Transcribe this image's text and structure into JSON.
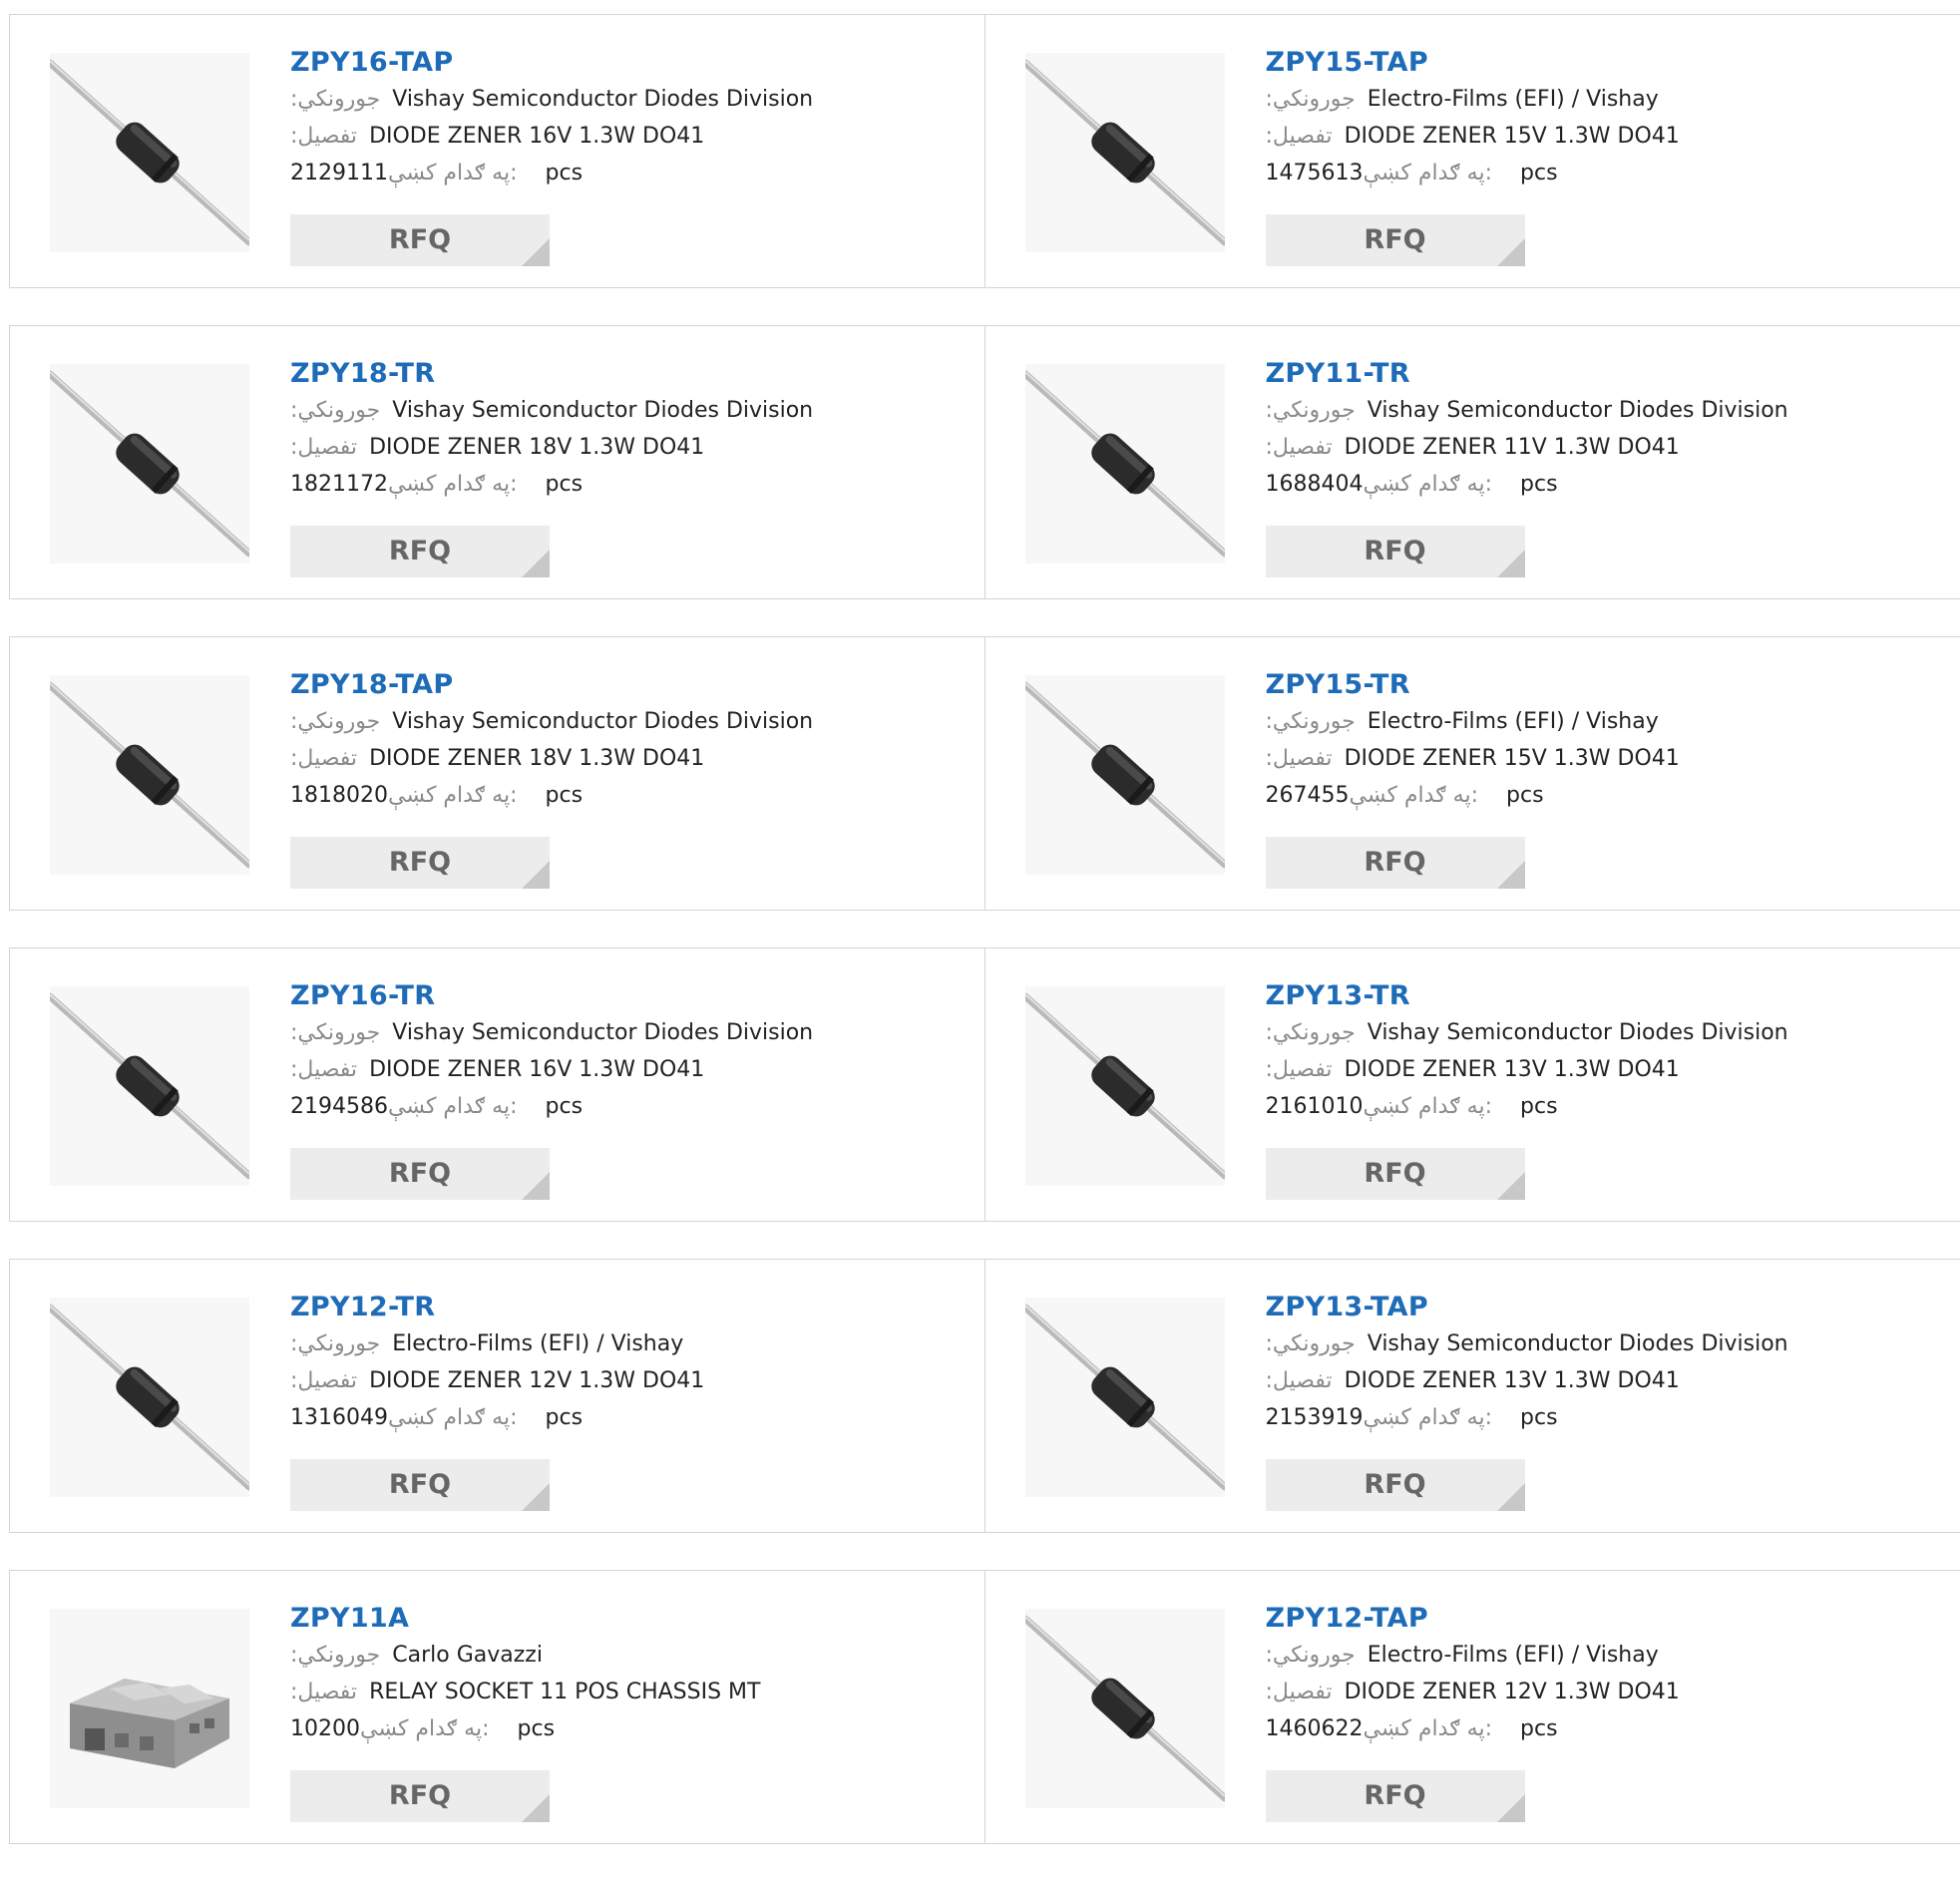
{
  "labels": {
    "manufacturer": ":جورونکي",
    "description": ":تفصيل",
    "stock": "په ګدام کښې:",
    "unit": "pcs",
    "rfq": "RFQ"
  },
  "products": [
    {
      "part": "ZPY16-TAP",
      "manufacturer": "Vishay Semiconductor Diodes Division",
      "description": "DIODE ZENER 16V 1.3W DO41",
      "stock": "2129111",
      "image": "diode-icon"
    },
    {
      "part": "ZPY15-TAP",
      "manufacturer": "Electro-Films (EFI) / Vishay",
      "description": "DIODE ZENER 15V 1.3W DO41",
      "stock": "1475613",
      "image": "diode-icon"
    },
    {
      "part": "ZPY18-TR",
      "manufacturer": "Vishay Semiconductor Diodes Division",
      "description": "DIODE ZENER 18V 1.3W DO41",
      "stock": "1821172",
      "image": "diode-icon"
    },
    {
      "part": "ZPY11-TR",
      "manufacturer": "Vishay Semiconductor Diodes Division",
      "description": "DIODE ZENER 11V 1.3W DO41",
      "stock": "1688404",
      "image": "diode-icon"
    },
    {
      "part": "ZPY18-TAP",
      "manufacturer": "Vishay Semiconductor Diodes Division",
      "description": "DIODE ZENER 18V 1.3W DO41",
      "stock": "1818020",
      "image": "diode-icon"
    },
    {
      "part": "ZPY15-TR",
      "manufacturer": "Electro-Films (EFI) / Vishay",
      "description": "DIODE ZENER 15V 1.3W DO41",
      "stock": "267455",
      "image": "diode-icon"
    },
    {
      "part": "ZPY16-TR",
      "manufacturer": "Vishay Semiconductor Diodes Division",
      "description": "DIODE ZENER 16V 1.3W DO41",
      "stock": "2194586",
      "image": "diode-icon"
    },
    {
      "part": "ZPY13-TR",
      "manufacturer": "Vishay Semiconductor Diodes Division",
      "description": "DIODE ZENER 13V 1.3W DO41",
      "stock": "2161010",
      "image": "diode-icon"
    },
    {
      "part": "ZPY12-TR",
      "manufacturer": "Electro-Films (EFI) / Vishay",
      "description": "DIODE ZENER 12V 1.3W DO41",
      "stock": "1316049",
      "image": "diode-icon"
    },
    {
      "part": "ZPY13-TAP",
      "manufacturer": "Vishay Semiconductor Diodes Division",
      "description": "DIODE ZENER 13V 1.3W DO41",
      "stock": "2153919",
      "image": "diode-icon"
    },
    {
      "part": "ZPY11A",
      "manufacturer": "Carlo Gavazzi",
      "description": "RELAY SOCKET 11 POS CHASSIS MT",
      "stock": "10200",
      "image": "relay-socket-icon"
    },
    {
      "part": "ZPY12-TAP",
      "manufacturer": "Electro-Films (EFI) / Vishay",
      "description": "DIODE ZENER 12V 1.3W DO41",
      "stock": "1460622",
      "image": "diode-icon"
    }
  ],
  "colors": {
    "part_link": "#1e6bb8",
    "label": "#8a8a8a",
    "border": "#d4d4d4",
    "rfq_bg": "#ececec"
  }
}
